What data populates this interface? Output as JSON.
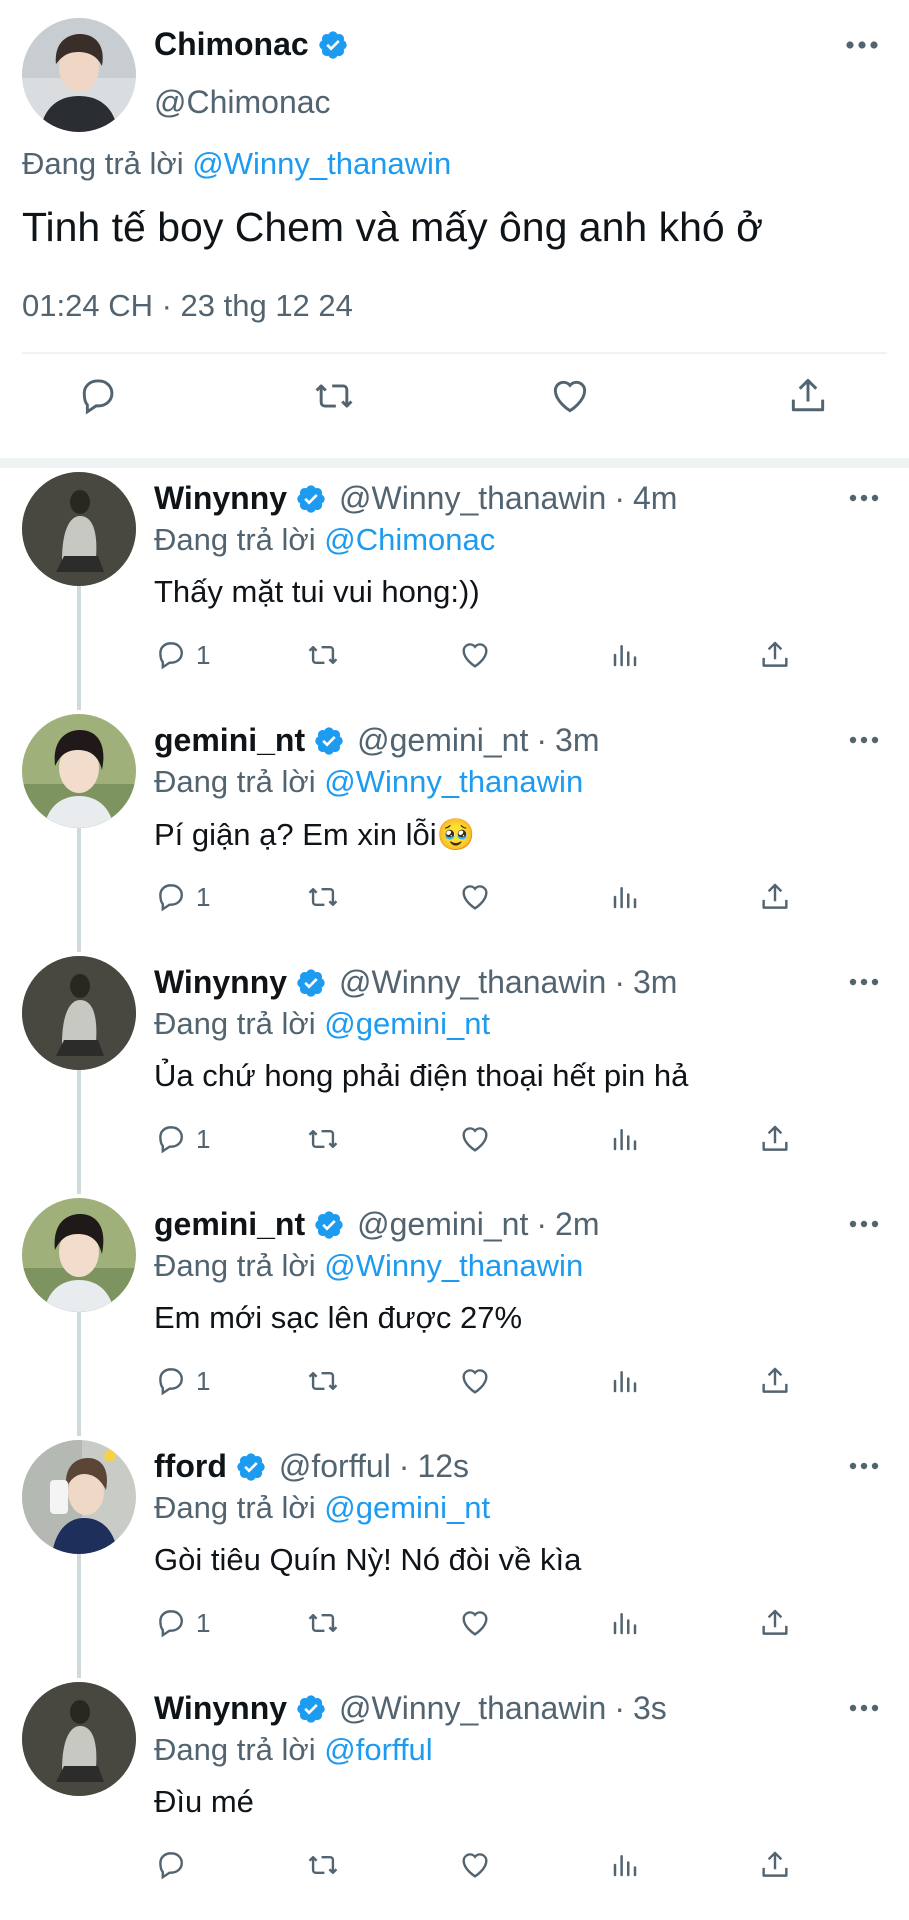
{
  "main_tweet": {
    "name": "Chimonac",
    "handle": "@Chimonac",
    "replying_prefix": "Đang trả lời",
    "replying_to": "@Winny_thanawin",
    "text": "Tinh tế boy Chem và mấy ông anh khó ở",
    "timestamp": "01:24 CH · 23 thg 12 24",
    "actions": [
      "reply-icon",
      "retweet-icon",
      "like-icon",
      "share-icon"
    ]
  },
  "replies": [
    {
      "name": "Winynny",
      "handle": "@Winny_thanawin",
      "dot": "·",
      "time": "4m",
      "replying_prefix": "Đang trả lời",
      "replying_to": "@Chimonac",
      "text": "Thấy mặt tui vui hong:))",
      "reply_count": "1"
    },
    {
      "name": "gemini_nt",
      "handle": "@gemini_nt",
      "dot": "·",
      "time": "3m",
      "replying_prefix": "Đang trả lời",
      "replying_to": "@Winny_thanawin",
      "text": "Pí giận ạ? Em xin lỗi🥹",
      "reply_count": "1"
    },
    {
      "name": "Winynny",
      "handle": "@Winny_thanawin",
      "dot": "·",
      "time": "3m",
      "replying_prefix": "Đang trả lời",
      "replying_to": "@gemini_nt",
      "text": "Ủa chứ hong phải điện thoại hết pin hả",
      "reply_count": "1"
    },
    {
      "name": "gemini_nt",
      "handle": "@gemini_nt",
      "dot": "·",
      "time": "2m",
      "replying_prefix": "Đang trả lời",
      "replying_to": "@Winny_thanawin",
      "text": "Em mới sạc lên được 27%",
      "reply_count": "1"
    },
    {
      "name": "fford",
      "handle": "@forfful",
      "dot": "·",
      "time": "12s",
      "replying_prefix": "Đang trả lời",
      "replying_to": "@gemini_nt",
      "text": "Gòi tiêu Quín Nỳ! Nó đòi về kìa",
      "reply_count": "1"
    },
    {
      "name": "Winynny",
      "handle": "@Winny_thanawin",
      "dot": "·",
      "time": "3s",
      "replying_prefix": "Đang trả lời",
      "replying_to": "@forfful",
      "text": "Đìu mé",
      "reply_count": ""
    }
  ],
  "colors": {
    "accent": "#1d9bf0",
    "text": "#0f1419",
    "secondary": "#536471",
    "divider": "#eff3f4",
    "thread": "#cfd9de"
  }
}
